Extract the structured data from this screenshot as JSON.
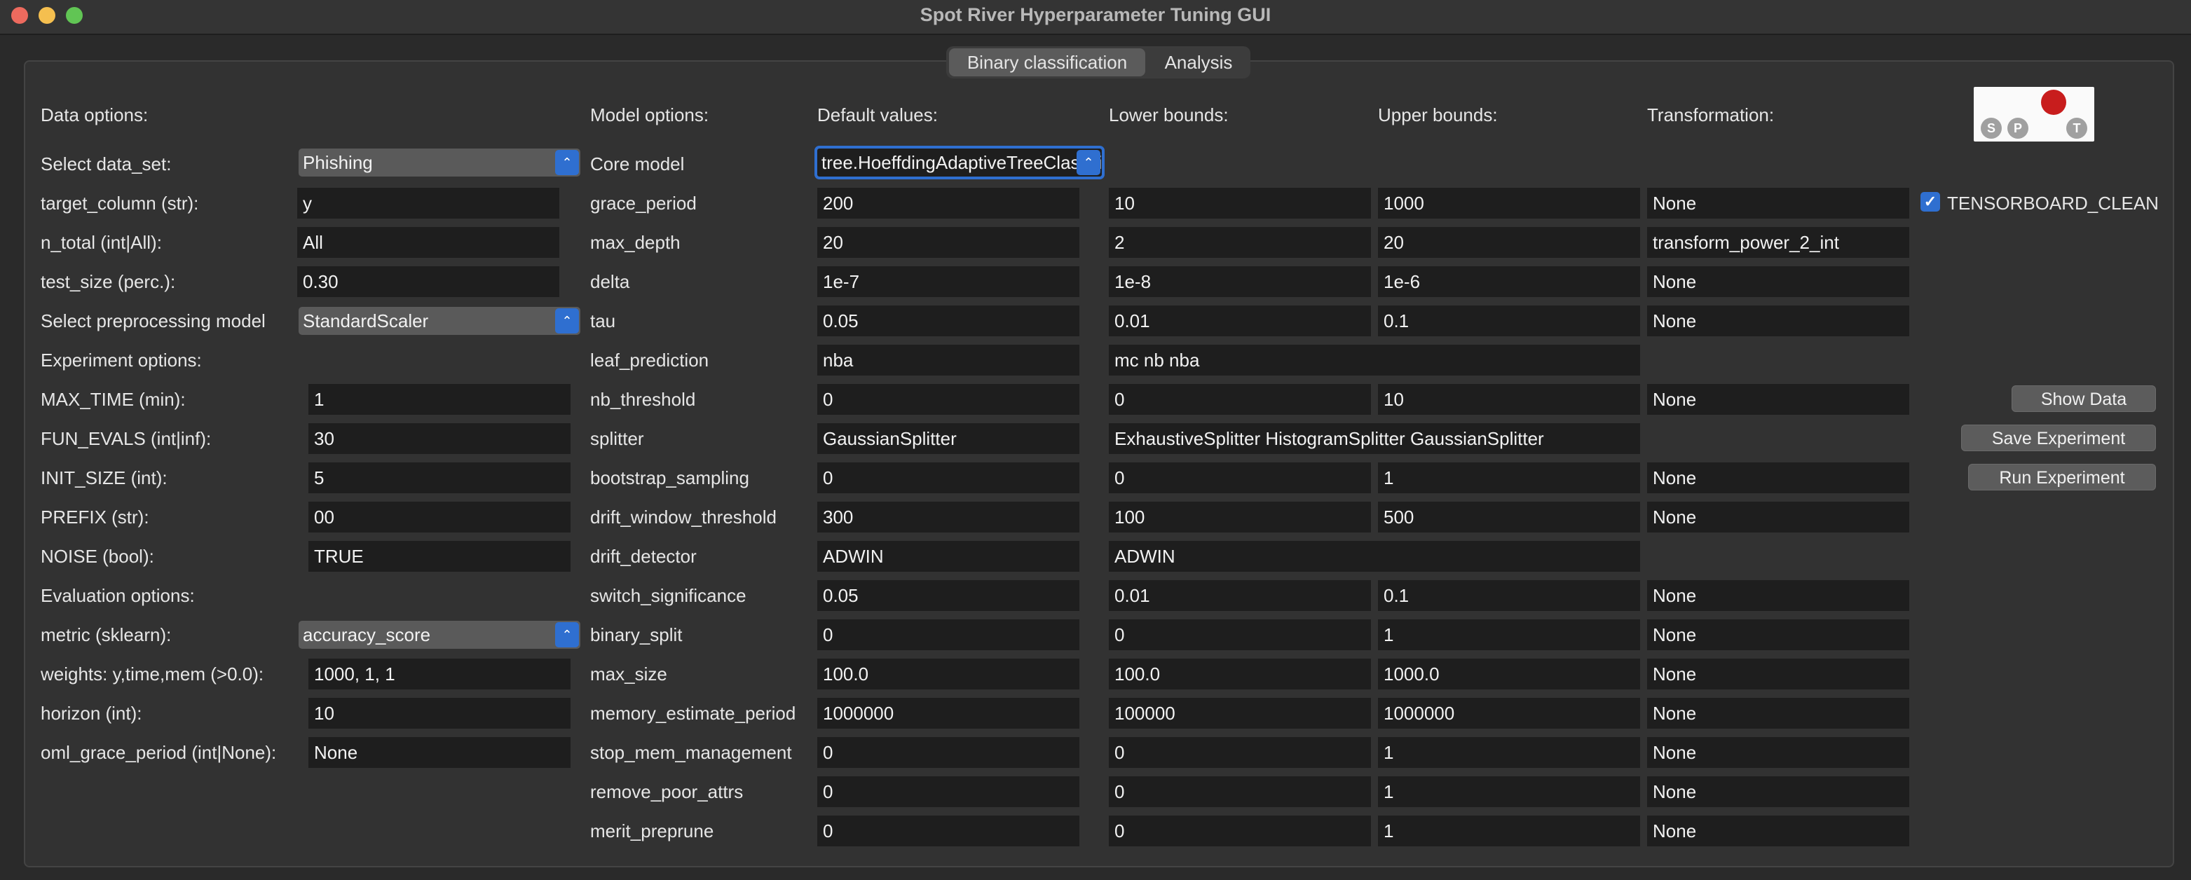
{
  "window": {
    "title": "Spot River Hyperparameter Tuning GUI"
  },
  "tabs": [
    {
      "label": "Binary classification",
      "active": true
    },
    {
      "label": "Analysis",
      "active": false
    }
  ],
  "left": {
    "data_options_header": "Data options:",
    "rows": [
      {
        "label": "Select data_set:",
        "type": "combo",
        "value": "Phishing"
      },
      {
        "label": "target_column (str):",
        "type": "field",
        "value": "y"
      },
      {
        "label": "n_total (int|All):",
        "type": "field",
        "value": "All"
      },
      {
        "label": "test_size (perc.):",
        "type": "field",
        "value": "0.30"
      },
      {
        "label": "Select preprocessing model",
        "type": "combo",
        "value": "StandardScaler"
      }
    ],
    "experiment_options_header": "Experiment options:",
    "experiment_rows": [
      {
        "label": "MAX_TIME (min):",
        "value": "1"
      },
      {
        "label": "FUN_EVALS (int|inf):",
        "value": "30"
      },
      {
        "label": "INIT_SIZE (int):",
        "value": "5"
      },
      {
        "label": "PREFIX (str):",
        "value": "00"
      },
      {
        "label": "NOISE (bool):",
        "value": "TRUE"
      }
    ],
    "evaluation_options_header": "Evaluation options:",
    "evaluation_rows": [
      {
        "label": "metric (sklearn):",
        "type": "combo",
        "value": "accuracy_score"
      },
      {
        "label": "weights: y,time,mem (>0.0):",
        "type": "field",
        "value": "1000, 1, 1"
      },
      {
        "label": "horizon (int):",
        "type": "field",
        "value": "10"
      },
      {
        "label": "oml_grace_period (int|None):",
        "type": "field",
        "value": "None"
      }
    ]
  },
  "model": {
    "headers": {
      "model_options": "Model options:",
      "default_values": "Default values:",
      "lower_bounds": "Lower bounds:",
      "upper_bounds": "Upper bounds:",
      "transformation": "Transformation:"
    },
    "core_model_label": "Core model",
    "core_model_value": "tree.HoeffdingAdaptiveTreeClassifier",
    "params": [
      {
        "name": "grace_period",
        "default": "200",
        "lower": "10",
        "upper": "1000",
        "transform": "None"
      },
      {
        "name": "max_depth",
        "default": "20",
        "lower": "2",
        "upper": "20",
        "transform": "transform_power_2_int"
      },
      {
        "name": "delta",
        "default": "1e-7",
        "lower": "1e-8",
        "upper": "1e-6",
        "transform": "None"
      },
      {
        "name": "tau",
        "default": "0.05",
        "lower": "0.01",
        "upper": "0.1",
        "transform": "None"
      },
      {
        "name": "leaf_prediction",
        "default": "nba",
        "levels": "mc nb nba"
      },
      {
        "name": "nb_threshold",
        "default": "0",
        "lower": "0",
        "upper": "10",
        "transform": "None"
      },
      {
        "name": "splitter",
        "default": "GaussianSplitter",
        "levels": "ExhaustiveSplitter HistogramSplitter GaussianSplitter"
      },
      {
        "name": "bootstrap_sampling",
        "default": "0",
        "lower": "0",
        "upper": "1",
        "transform": "None"
      },
      {
        "name": "drift_window_threshold",
        "default": "300",
        "lower": "100",
        "upper": "500",
        "transform": "None"
      },
      {
        "name": "drift_detector",
        "default": "ADWIN",
        "levels": "ADWIN"
      },
      {
        "name": "switch_significance",
        "default": "0.05",
        "lower": "0.01",
        "upper": "0.1",
        "transform": "None"
      },
      {
        "name": "binary_split",
        "default": "0",
        "lower": "0",
        "upper": "1",
        "transform": "None"
      },
      {
        "name": "max_size",
        "default": "100.0",
        "lower": "100.0",
        "upper": "1000.0",
        "transform": "None"
      },
      {
        "name": "memory_estimate_period",
        "default": "1000000",
        "lower": "100000",
        "upper": "1000000",
        "transform": "None"
      },
      {
        "name": "stop_mem_management",
        "default": "0",
        "lower": "0",
        "upper": "1",
        "transform": "None"
      },
      {
        "name": "remove_poor_attrs",
        "default": "0",
        "lower": "0",
        "upper": "1",
        "transform": "None"
      },
      {
        "name": "merit_preprune",
        "default": "0",
        "lower": "0",
        "upper": "1",
        "transform": "None"
      }
    ]
  },
  "right": {
    "tensorboard_label": "TENSORBOARD_CLEAN",
    "tensorboard_checked": true,
    "show_data_button": "Show Data",
    "save_experiment_button": "Save Experiment",
    "run_experiment_button": "Run Experiment",
    "logo_letters": [
      "S",
      "P",
      "T"
    ]
  },
  "colors": {
    "accent": "#2f6fd0",
    "logo_dot": "#c81d1d"
  }
}
